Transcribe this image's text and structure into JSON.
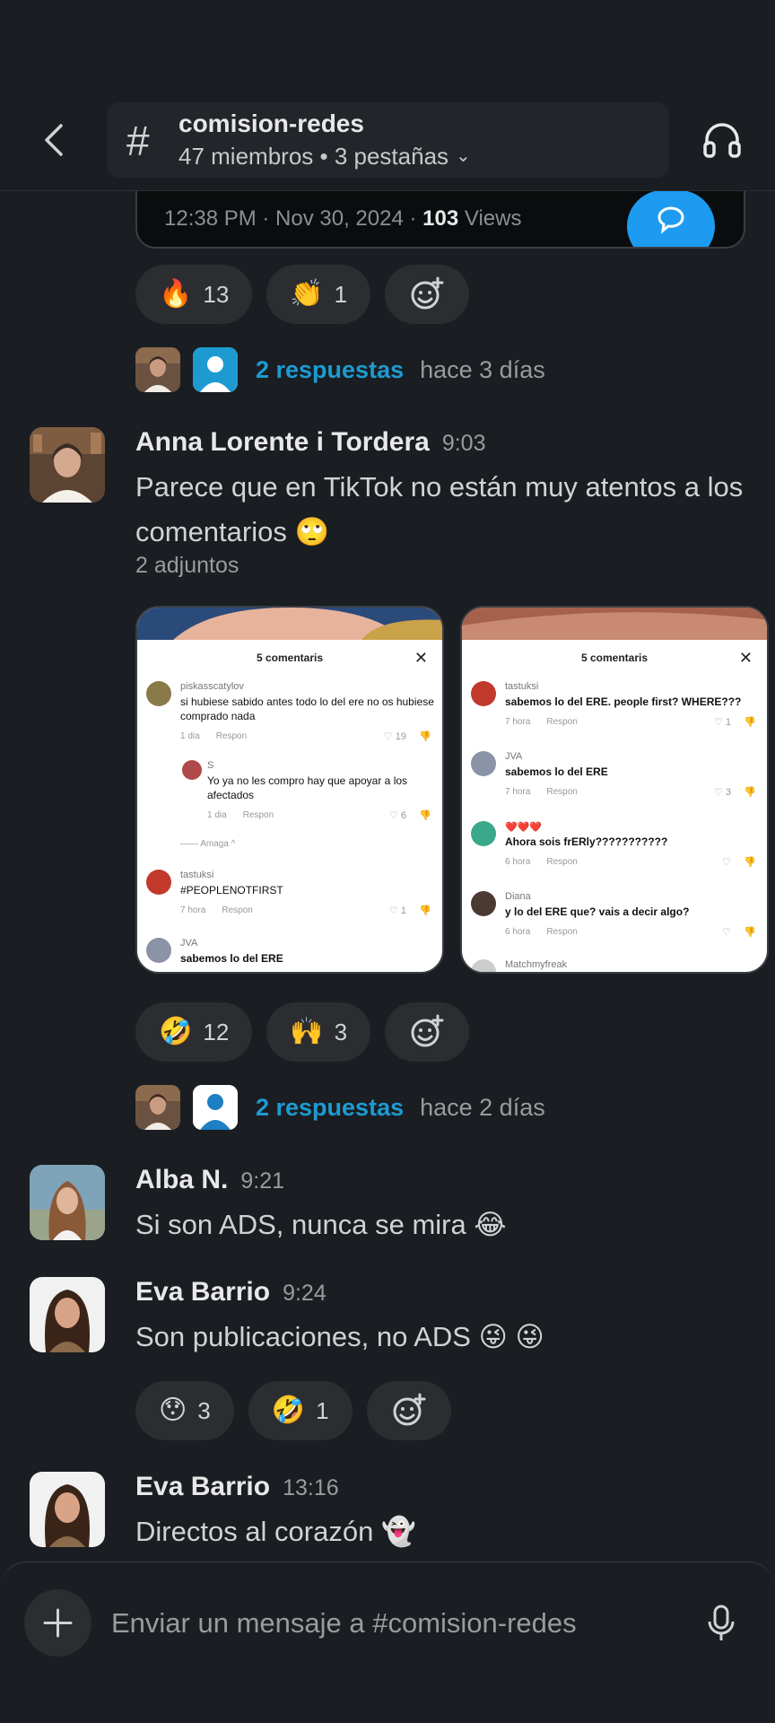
{
  "header": {
    "channel_name": "comision-redes",
    "channel_meta": "47 miembros • 3 pestañas",
    "hash_symbol": "#"
  },
  "tweet_card": {
    "meta_prefix": "12:38 PM · Nov 30, 2024 · ",
    "views_count": "103",
    "views_label": " Views"
  },
  "messages": [
    {
      "reactions": [
        {
          "emoji": "🔥",
          "count": "13"
        },
        {
          "emoji": "👏",
          "count": "1"
        }
      ],
      "thread": {
        "replies": "2 respuestas",
        "time": "hace 3 días"
      }
    },
    {
      "author": "Anna Lorente i Tordera",
      "time": "9:03",
      "text": "Parece que en TikTok no están muy atentos a los comentarios 🙄",
      "attachments_label": "2 adjuntos",
      "reactions": [
        {
          "emoji": "🤣",
          "count": "12"
        },
        {
          "emoji": "🙌",
          "count": "3"
        }
      ],
      "thread": {
        "replies": "2 respuestas",
        "time": "hace 2 días"
      }
    },
    {
      "author": "Alba N.",
      "time": "9:21",
      "text": "Si son ADS, nunca se mira 😂"
    },
    {
      "author": "Eva Barrio",
      "time": "9:24",
      "text": "Son publicaciones, no ADS 😜 😜",
      "reactions": [
        {
          "emoji": "😯",
          "count": "3"
        },
        {
          "emoji": "🤣",
          "count": "1"
        }
      ]
    },
    {
      "author": "Eva Barrio",
      "time": "13:16",
      "text": "Directos al corazón 👻"
    }
  ],
  "attachments": [
    {
      "title": "5 comentaris",
      "comments": [
        {
          "user": "piskasscatylov",
          "text": "si hubiese sabido antes todo lo del ere no os hubiese comprado nada",
          "meta": "1 dia",
          "reply": "Respon",
          "likes": "19"
        },
        {
          "user": "S",
          "text": "Yo ya no les compro hay que apoyar a los afectados",
          "meta": "1 dia",
          "reply": "Respon",
          "likes": "6"
        },
        {
          "user": "tastuksi",
          "text": "#PEOPLENOTFIRST",
          "meta": "7 hora",
          "reply": "Respon",
          "likes": "1"
        },
        {
          "user": "JVA",
          "text": "sabemos lo del ERE"
        }
      ],
      "collapse": "—— Amaga ^"
    },
    {
      "title": "5 comentaris",
      "comments": [
        {
          "user": "tastuksi",
          "text": "sabemos lo del ERE. people first? WHERE???",
          "meta": "7 hora",
          "reply": "Respon",
          "likes": "1"
        },
        {
          "user": "JVA",
          "text": "sabemos lo del ERE",
          "meta": "7 hora",
          "reply": "Respon",
          "likes": "3"
        },
        {
          "user": "❤️❤️❤️",
          "text": "Ahora sois frERly???????????",
          "meta": "6 hora",
          "reply": "Respon",
          "likes": ""
        },
        {
          "user": "Diana",
          "text": "y lo del ERE que? vais a decir algo?",
          "meta": "6 hora",
          "reply": "Respon",
          "likes": ""
        },
        {
          "user": "Matchmyfreak",
          "text": ""
        }
      ]
    }
  ],
  "composer": {
    "placeholder": "Enviar un mensaje a #comision-redes"
  },
  "colors": {
    "background": "#1a1d21",
    "link": "#1d9bd1",
    "pill": "#2b2d31",
    "twitter_blue": "#1d9bf0"
  },
  "icons": [
    "back-arrow-icon",
    "hash-icon",
    "chevron-down-icon",
    "headphones-icon",
    "add-reaction-icon",
    "plus-icon",
    "microphone-icon",
    "reply-bubble-icon"
  ]
}
